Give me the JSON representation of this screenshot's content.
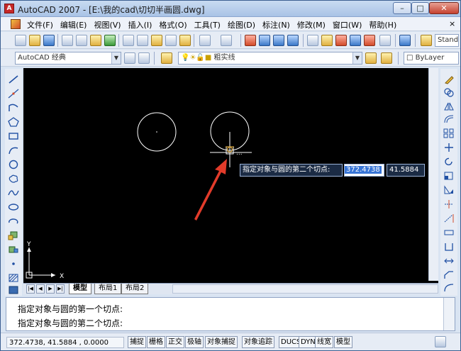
{
  "window": {
    "title": "AutoCAD 2007 - [E:\\我的cad\\切切半画圆.dwg]",
    "min_glyph": "–",
    "max_glyph": "□",
    "close_glyph": "✕",
    "app_icon_glyph": "A"
  },
  "menubar": {
    "items": [
      "文件(F)",
      "编辑(E)",
      "视图(V)",
      "插入(I)",
      "格式(O)",
      "工具(T)",
      "绘图(D)",
      "标注(N)",
      "修改(M)",
      "窗口(W)",
      "帮助(H)"
    ],
    "close_glyph": "×"
  },
  "toolbar": {
    "text_style_combo": "Standard",
    "workspace_combo": "AutoCAD 经典",
    "layer_combo": "粗实线",
    "color_combo": "ByLayer"
  },
  "canvas": {
    "prompt_label": "指定对象与圆的第二个切点:",
    "input_x": "372.4738",
    "input_y": "41.5884",
    "ucs_x_label": "X",
    "ucs_y_label": "Y",
    "background_color": "#000000",
    "arrow_color": "#e23b2a"
  },
  "layout_tabs": {
    "nav_first": "|◀",
    "nav_prev": "◀",
    "nav_next": "▶",
    "nav_last": "▶|",
    "tabs": [
      "模型",
      "布局1",
      "布局2"
    ]
  },
  "command": {
    "line1": "指定对象与圆的第一个切点:",
    "line2": "指定对象与圆的第二个切点:"
  },
  "statusbar": {
    "coords": "372.4738,  41.5884 ,  0.0000",
    "buttons": [
      "捕捉",
      "栅格",
      "正交",
      "极轴",
      "对象捕捉",
      "对象追踪",
      "DUCS",
      "DYN",
      "线宽",
      "模型"
    ]
  }
}
